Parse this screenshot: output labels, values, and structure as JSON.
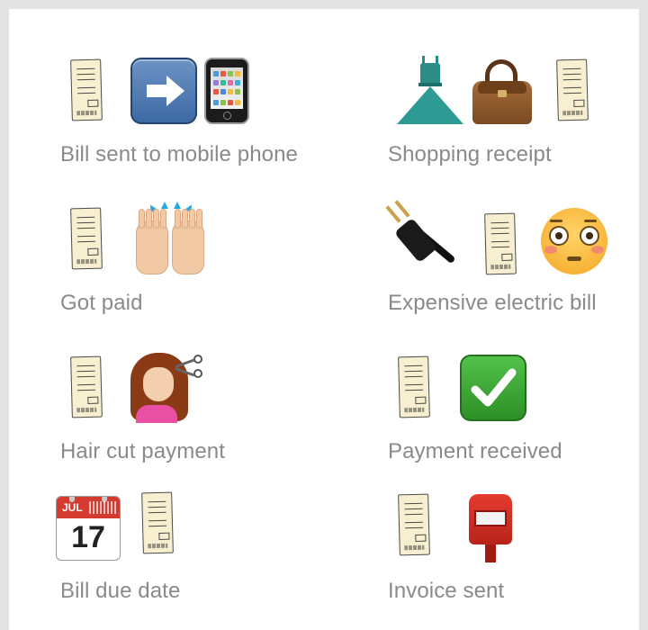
{
  "items": [
    {
      "label": "Bill sent to mobile phone",
      "icons": [
        "receipt-icon",
        "right-arrow-icon",
        "mobile-phone-icon"
      ]
    },
    {
      "label": "Shopping receipt",
      "icons": [
        "dress-icon",
        "handbag-icon",
        "receipt-icon"
      ]
    },
    {
      "label": "Got paid",
      "icons": [
        "receipt-icon",
        "raised-hands-icon"
      ]
    },
    {
      "label": "Expensive electric bill",
      "icons": [
        "electric-plug-icon",
        "receipt-icon",
        "flushed-face-icon"
      ]
    },
    {
      "label": "Hair cut payment",
      "icons": [
        "receipt-icon",
        "haircut-icon"
      ]
    },
    {
      "label": "Payment received",
      "icons": [
        "receipt-icon",
        "check-mark-button-icon"
      ]
    },
    {
      "label": "Bill due date",
      "icons": [
        "calendar-icon",
        "receipt-icon"
      ]
    },
    {
      "label": "Invoice sent",
      "icons": [
        "receipt-icon",
        "postbox-icon"
      ]
    }
  ],
  "calendar": {
    "month": "JUL",
    "day": "17"
  },
  "colors": {
    "label": "#8a8a8a",
    "background": "#e3e3e3",
    "card": "#ffffff"
  }
}
